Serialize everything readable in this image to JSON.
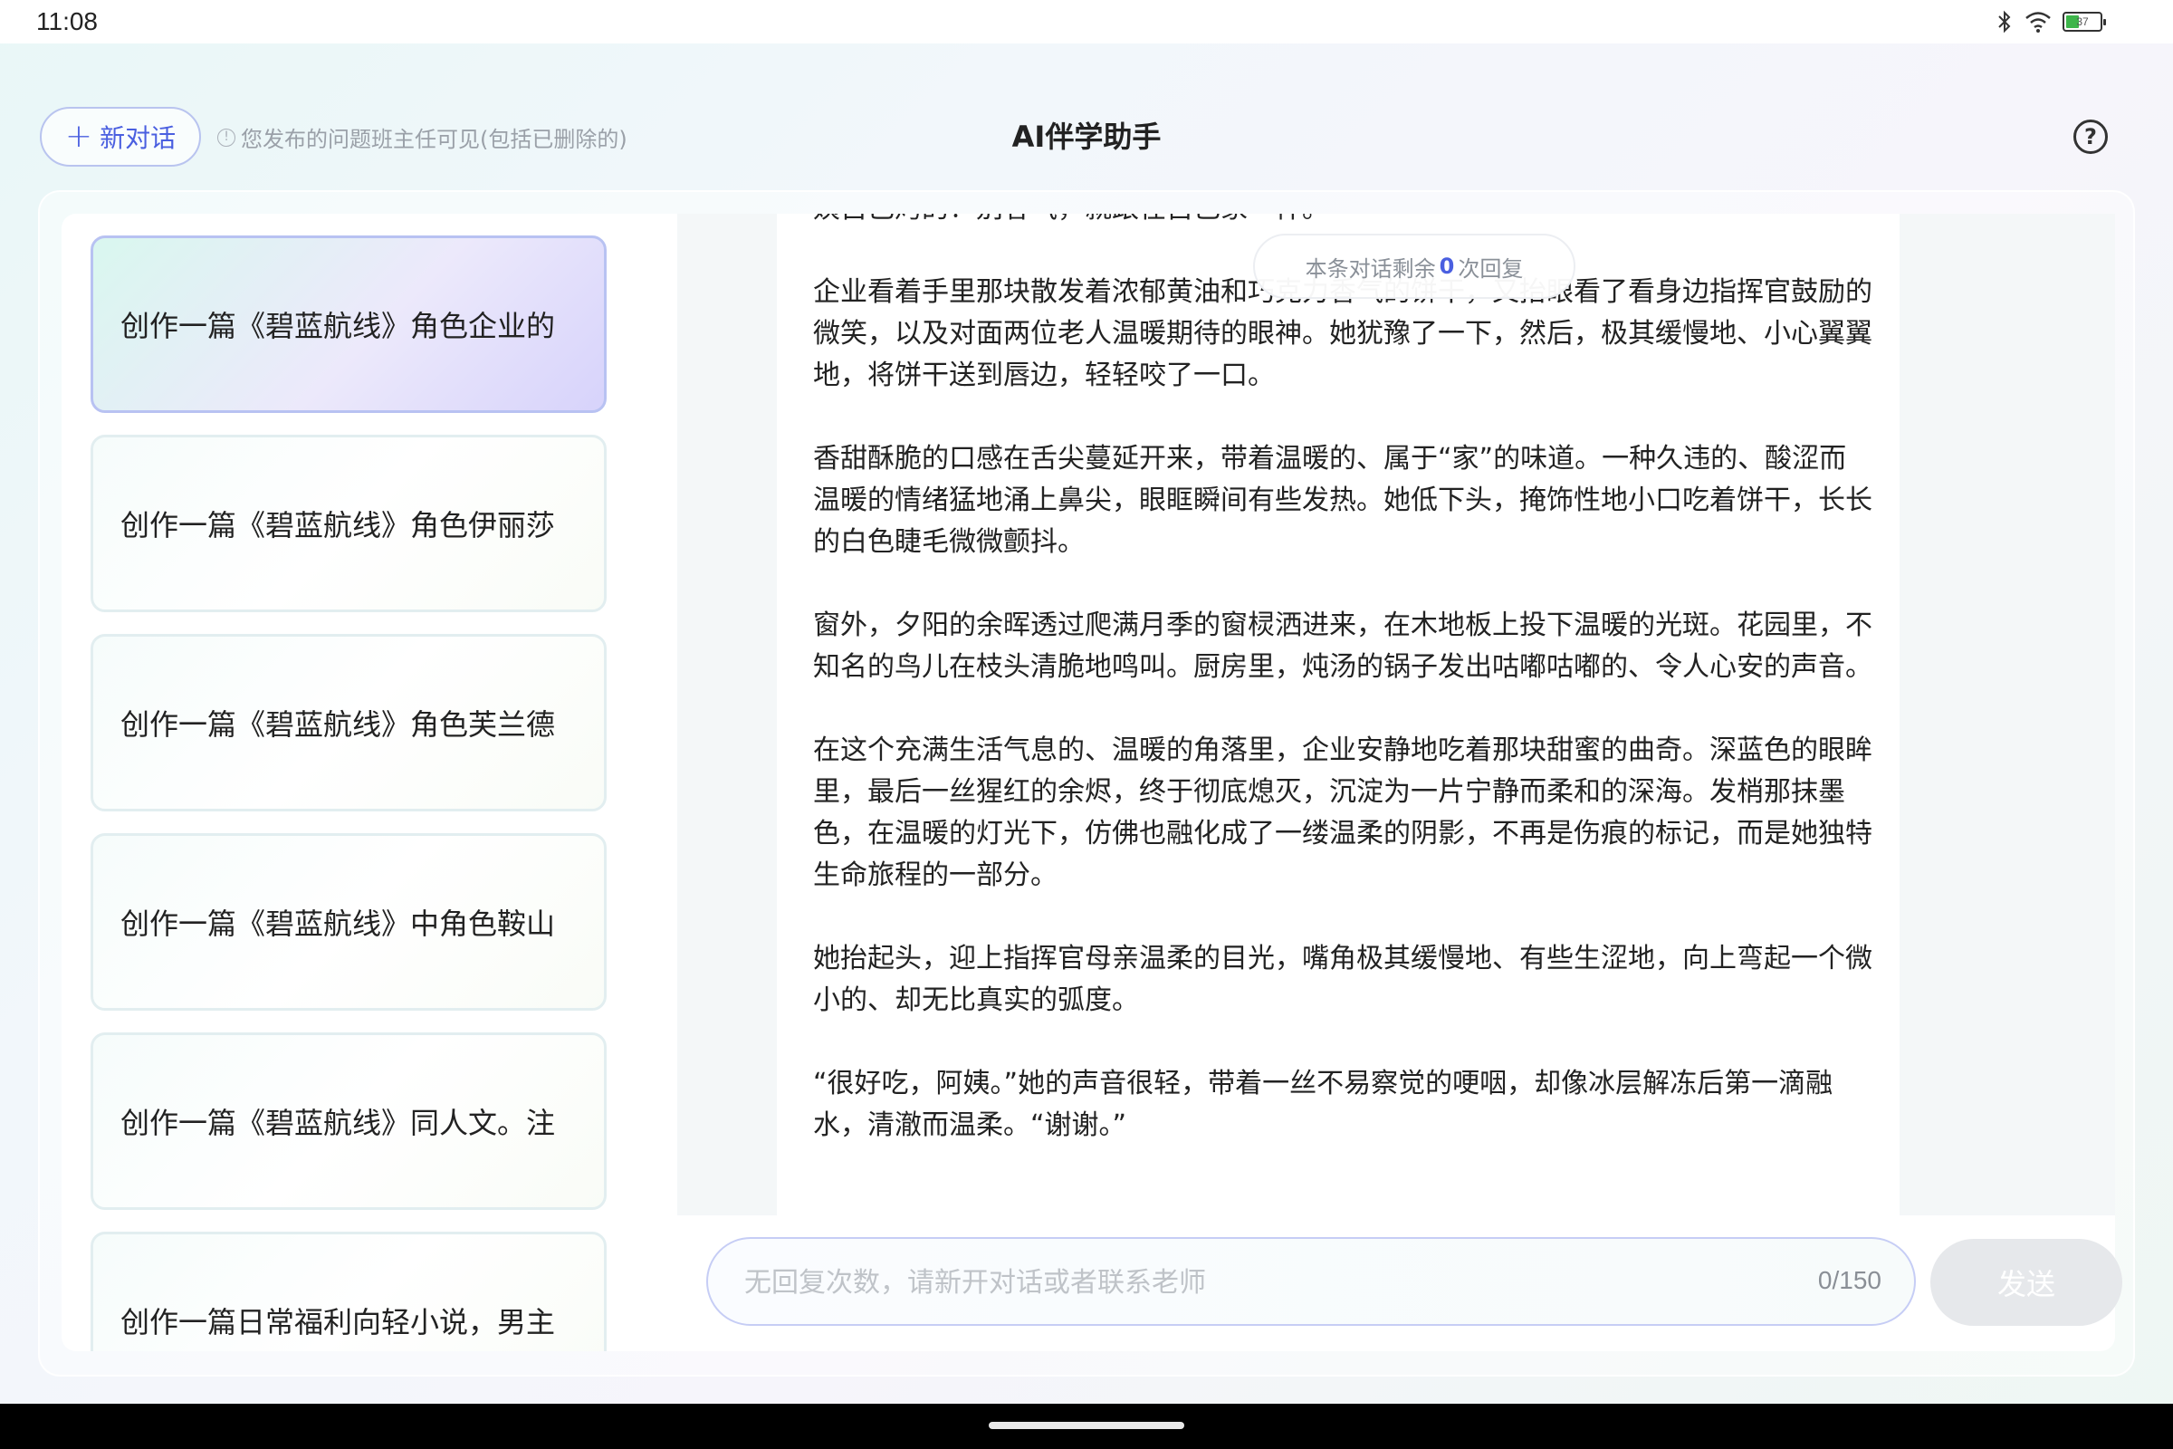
{
  "status_bar": {
    "time": "11:08",
    "battery_level": "37",
    "icons": [
      "bluetooth-icon",
      "wifi-icon",
      "battery-icon"
    ]
  },
  "header": {
    "new_chat_label": "新对话",
    "notice": "您发布的问题班主任可见(包括已删除的)",
    "title": "AI伴学助手"
  },
  "sidebar": {
    "items": [
      {
        "label": "创作一篇《碧蓝航线》角色企业的",
        "active": true
      },
      {
        "label": "创作一篇《碧蓝航线》角色伊丽莎",
        "active": false
      },
      {
        "label": "创作一篇《碧蓝航线》角色芙兰德",
        "active": false
      },
      {
        "label": "创作一篇《碧蓝航线》中角色鞍山",
        "active": false
      },
      {
        "label": "创作一篇《碧蓝航线》同人文。注",
        "active": false
      },
      {
        "label": "创作一篇日常福利向轻小说，男主",
        "active": false
      }
    ]
  },
  "chat": {
    "remaining_prefix": "本条对话剩余",
    "remaining_count": "0",
    "remaining_suffix": "次回复",
    "paragraphs": [
      "姨自己烤的！别客气，就跟在自己家一样。”",
      "企业看着手里那块散发着浓郁黄油和巧克力香气的饼干，又抬眼看了看身边指挥官鼓励的微笑，以及对面两位老人温暖期待的眼神。她犹豫了一下，然后，极其缓慢地、小心翼翼地，将饼干送到唇边，轻轻咬了一口。",
      "香甜酥脆的口感在舌尖蔓延开来，带着温暖的、属于“家”的味道。一种久违的、酸涩而温暖的情绪猛地涌上鼻尖，眼眶瞬间有些发热。她低下头，掩饰性地小口吃着饼干，长长的白色睫毛微微颤抖。",
      "窗外，夕阳的余晖透过爬满月季的窗棂洒进来，在木地板上投下温暖的光斑。花园里，不知名的鸟儿在枝头清脆地鸣叫。厨房里，炖汤的锅子发出咕嘟咕嘟的、令人心安的声音。",
      "在这个充满生活气息的、温暖的角落里，企业安静地吃着那块甜蜜的曲奇。深蓝色的眼眸里，最后一丝猩红的余烬，终于彻底熄灭，沉淀为一片宁静而柔和的深海。发梢那抹墨色，在温暖的灯光下，仿佛也融化成了一缕温柔的阴影，不再是伤痕的标记，而是她独特生命旅程的一部分。",
      "她抬起头，迎上指挥官母亲温柔的目光，嘴角极其缓慢地、有些生涩地，向上弯起一个微小的、却无比真实的弧度。",
      "“很好吃，阿姨。”她的声音很轻，带着一丝不易察觉的哽咽，却像冰层解冻后第一滴融水，清澈而温柔。“谢谢。”"
    ]
  },
  "input": {
    "placeholder": "无回复次数，请新开对话或者联系老师",
    "char_count": "0/150",
    "send_label": "发送"
  },
  "colors": {
    "accent": "#4a5fe0",
    "active_item_border": "#b8c2f2",
    "send_disabled": "#e6e8eb"
  }
}
